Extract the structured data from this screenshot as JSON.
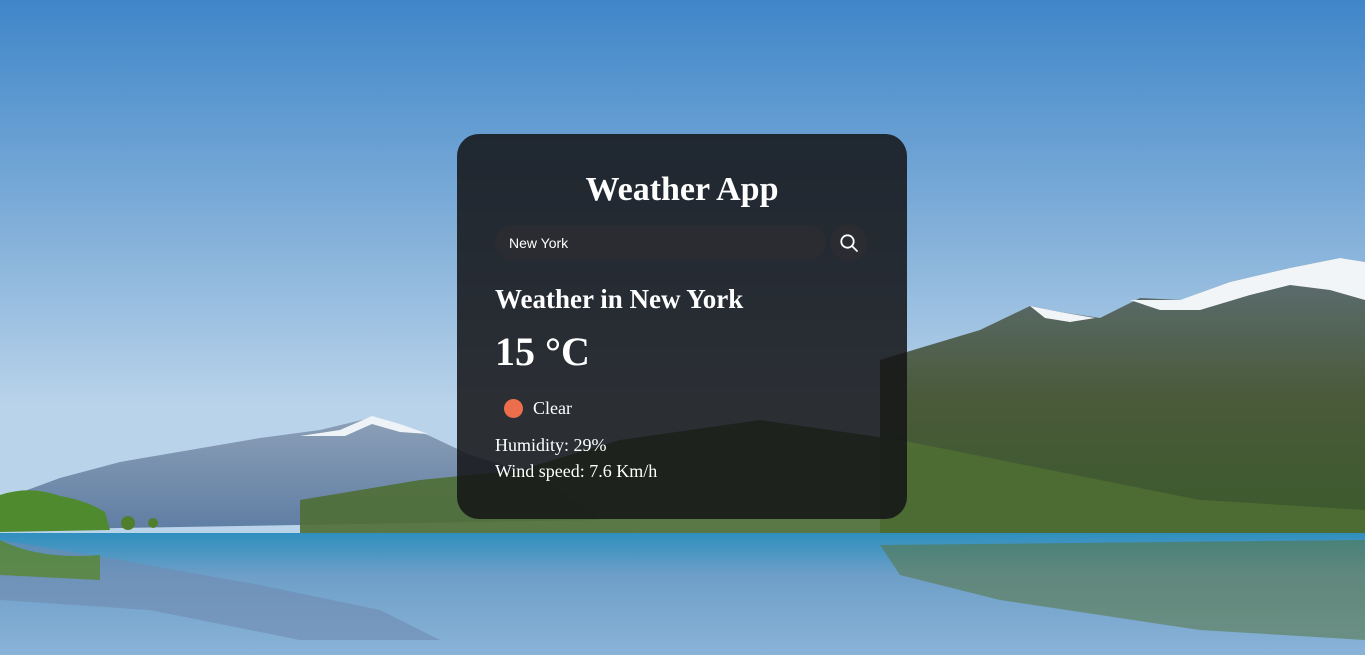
{
  "app": {
    "title": "Weather App"
  },
  "search": {
    "value": "New York",
    "placeholder": "",
    "button_icon": "search-icon"
  },
  "weather": {
    "heading": "Weather in New York",
    "temperature_value": "15",
    "temperature_unit": "°C",
    "condition_label": "Clear",
    "condition_icon": "sun-icon",
    "humidity": "Humidity: 29%",
    "wind": "Wind speed: 7.6 Km/h"
  },
  "colors": {
    "card_background": "#141416",
    "input_background": "#2b2c31",
    "condition_icon": "#ec6e4c",
    "text": "#ffffff"
  },
  "background": {
    "description_icon": "mountain-lake-landscape"
  }
}
